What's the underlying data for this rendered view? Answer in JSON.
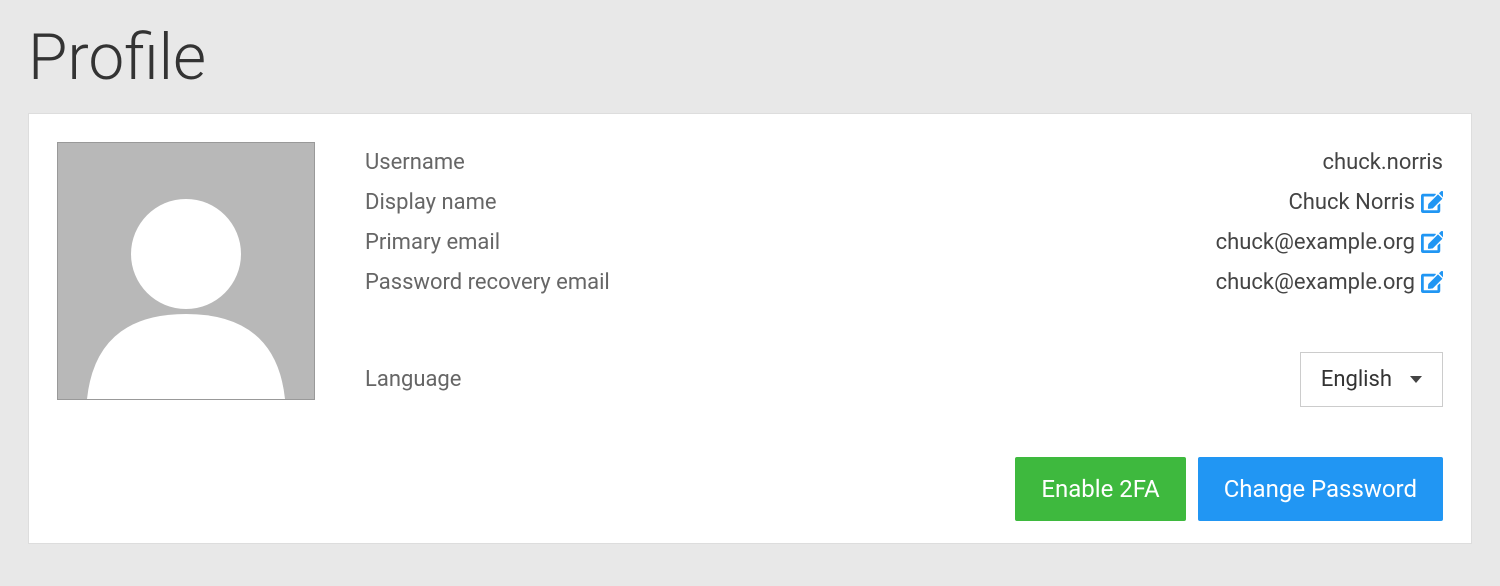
{
  "page": {
    "title": "Profile"
  },
  "profile": {
    "username_label": "Username",
    "username_value": "chuck.norris",
    "displayname_label": "Display name",
    "displayname_value": "Chuck Norris",
    "primaryemail_label": "Primary email",
    "primaryemail_value": "chuck@example.org",
    "recoveryemail_label": "Password recovery email",
    "recoveryemail_value": "chuck@example.org",
    "language_label": "Language",
    "language_value": "English"
  },
  "buttons": {
    "enable_2fa": "Enable 2FA",
    "change_password": "Change Password"
  }
}
